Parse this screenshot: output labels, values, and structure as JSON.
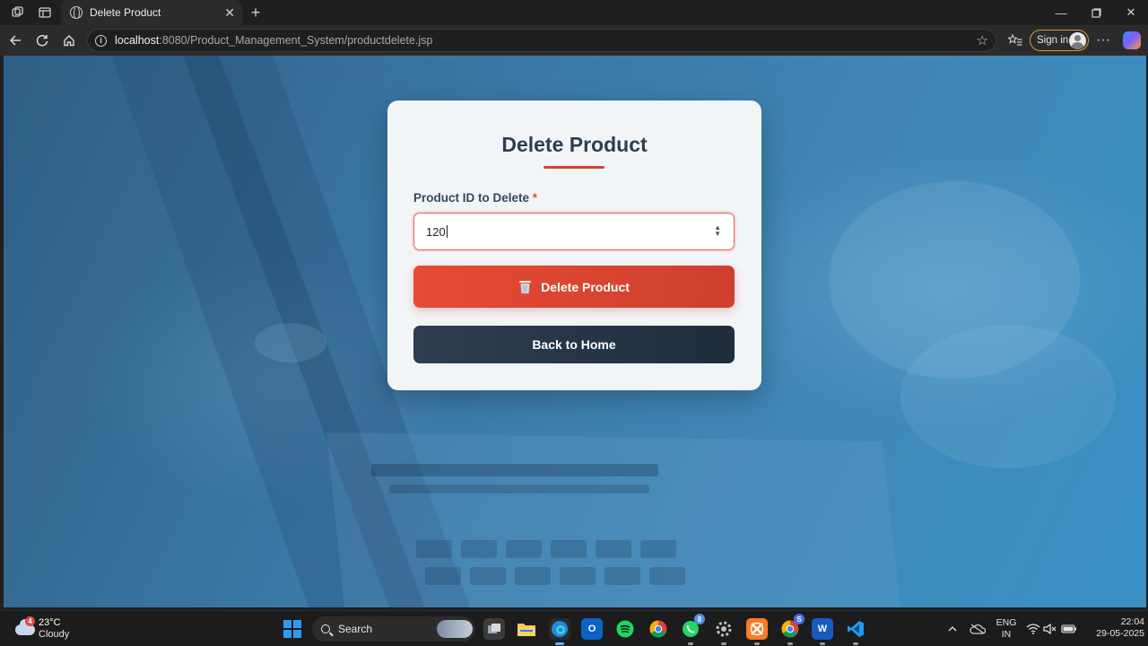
{
  "browser": {
    "tab_title": "Delete Product",
    "url_host": "localhost",
    "url_rest": ":8080/Product_Management_System/productdelete.jsp",
    "signin_label": "Sign in"
  },
  "page": {
    "title": "Delete Product",
    "field_label": "Product ID to Delete",
    "required_mark": "*",
    "product_id_value": "120",
    "delete_button_label": "Delete Product",
    "home_button_label": "Back to Home"
  },
  "taskbar": {
    "temperature": "23°C",
    "condition": "Cloudy",
    "weather_badge": "4",
    "search_label": "Search",
    "whatsapp_badge": "8",
    "chrome_badge": "S",
    "lang_line1": "ENG",
    "lang_line2": "IN",
    "time": "22:04",
    "date": "29-05-2025"
  },
  "colors": {
    "accent_red": "#e64b35",
    "dark_navy": "#2c3e50",
    "page_bg": "#3a76a3"
  },
  "icons": [
    "workspaces-icon",
    "tab-actions-icon",
    "globe-icon",
    "close-icon",
    "new-tab-icon",
    "minimize-icon",
    "maximize-icon",
    "window-close-icon",
    "back-icon",
    "refresh-icon",
    "home-icon",
    "info-icon",
    "favorite-star-icon",
    "favorites-icon",
    "avatar-icon",
    "more-icon",
    "copilot-icon",
    "trash-icon",
    "spinner-icon",
    "windows-start-icon",
    "search-icon"
  ]
}
